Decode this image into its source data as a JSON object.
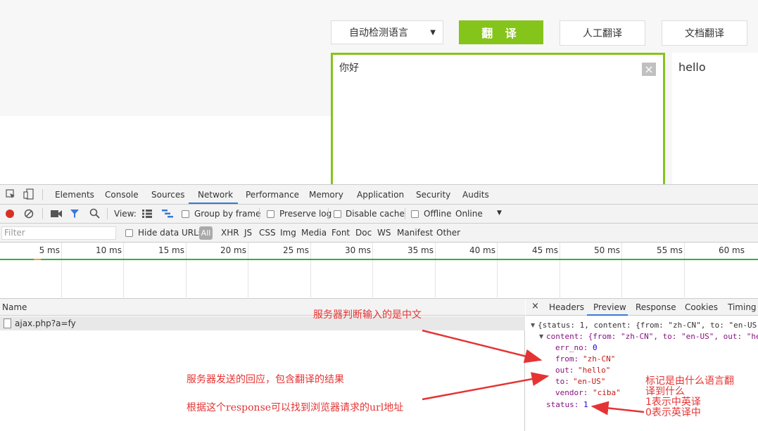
{
  "translator": {
    "lang_select": "自动检测语言",
    "translate_btn": "翻 译",
    "human_btn": "人工翻译",
    "doc_btn": "文档翻译",
    "input_text": "你好",
    "clear_icon": "×",
    "output_text": "hello"
  },
  "devtools": {
    "tabs": [
      "Elements",
      "Console",
      "Sources",
      "Network",
      "Performance",
      "Memory",
      "Application",
      "Security",
      "Audits"
    ],
    "active_tab": "Network",
    "toolbar": {
      "view_label": "View:",
      "group_by_frame": "Group by frame",
      "preserve_log": "Preserve log",
      "disable_cache": "Disable cache",
      "offline": "Offline",
      "online": "Online"
    },
    "filter": {
      "placeholder": "Filter",
      "hide_data_urls": "Hide data URLs",
      "all": "All",
      "types": [
        "XHR",
        "JS",
        "CSS",
        "Img",
        "Media",
        "Font",
        "Doc",
        "WS",
        "Manifest",
        "Other"
      ]
    },
    "timeline_ticks": [
      "5 ms",
      "10 ms",
      "15 ms",
      "20 ms",
      "25 ms",
      "30 ms",
      "35 ms",
      "40 ms",
      "45 ms",
      "50 ms",
      "55 ms",
      "60 ms"
    ],
    "name_header": "Name",
    "request_name": "ajax.php?a=fy",
    "preview_tabs": [
      "Headers",
      "Preview",
      "Response",
      "Cookies",
      "Timing"
    ],
    "preview_active": "Preview",
    "json_lines": {
      "root": "{status: 1, content: {from: \"zh-CN\", to: \"en-US\"",
      "content": "content: {from: \"zh-CN\", to: \"en-US\", out: \"he",
      "err_no_key": "err_no:",
      "err_no_val": "0",
      "from_key": "from:",
      "from_val": "\"zh-CN\"",
      "out_key": "out:",
      "out_val": "\"hello\"",
      "to_key": "to:",
      "to_val": "\"en-US\"",
      "vendor_key": "vendor:",
      "vendor_val": "\"ciba\"",
      "status_key": "status:",
      "status_val": "1"
    }
  },
  "annotations": {
    "a1": "服务器判断输入的是中文",
    "a2": "服务器发送的回应，包含翻译的结果",
    "a3": "根据这个response可以找到浏览器请求的url地址",
    "a4_l1": "标记是由什么语言翻",
    "a4_l2": "译到什么",
    "a4_l3": "1表示中英译",
    "a4_l4": "0表示英译中"
  },
  "colors": {
    "accent_green": "#85c41a",
    "annotation_red": "#e53333",
    "devtools_blue": "#3879d9"
  }
}
